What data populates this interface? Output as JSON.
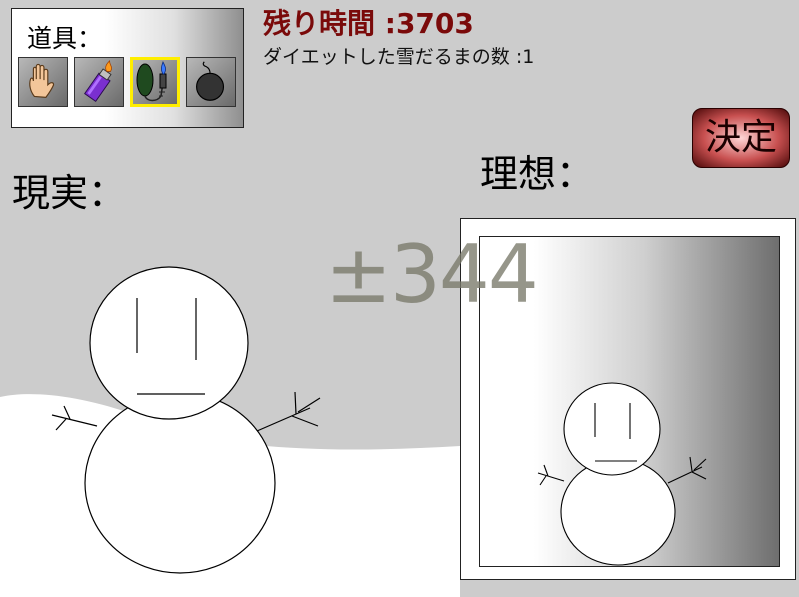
{
  "tools": {
    "title": "道具：",
    "items": [
      {
        "name": "hand",
        "icon": "hand-icon"
      },
      {
        "name": "lighter",
        "icon": "lighter-icon"
      },
      {
        "name": "burner",
        "icon": "gas-burner-icon",
        "selected": true
      },
      {
        "name": "bomb",
        "icon": "bomb-icon"
      }
    ]
  },
  "status": {
    "time_label": "残り時間 :3703",
    "count_label": "ダイエットした雪だるまの数 :1"
  },
  "decide_label": "決定",
  "reality_label": "現実：",
  "ideal_label": "理想：",
  "difference_label": "±344",
  "colors": {
    "background": "#cccccc",
    "time_text": "#7a0a0a",
    "selected_tool": "#ffee00",
    "decide_button": "#c85050"
  }
}
